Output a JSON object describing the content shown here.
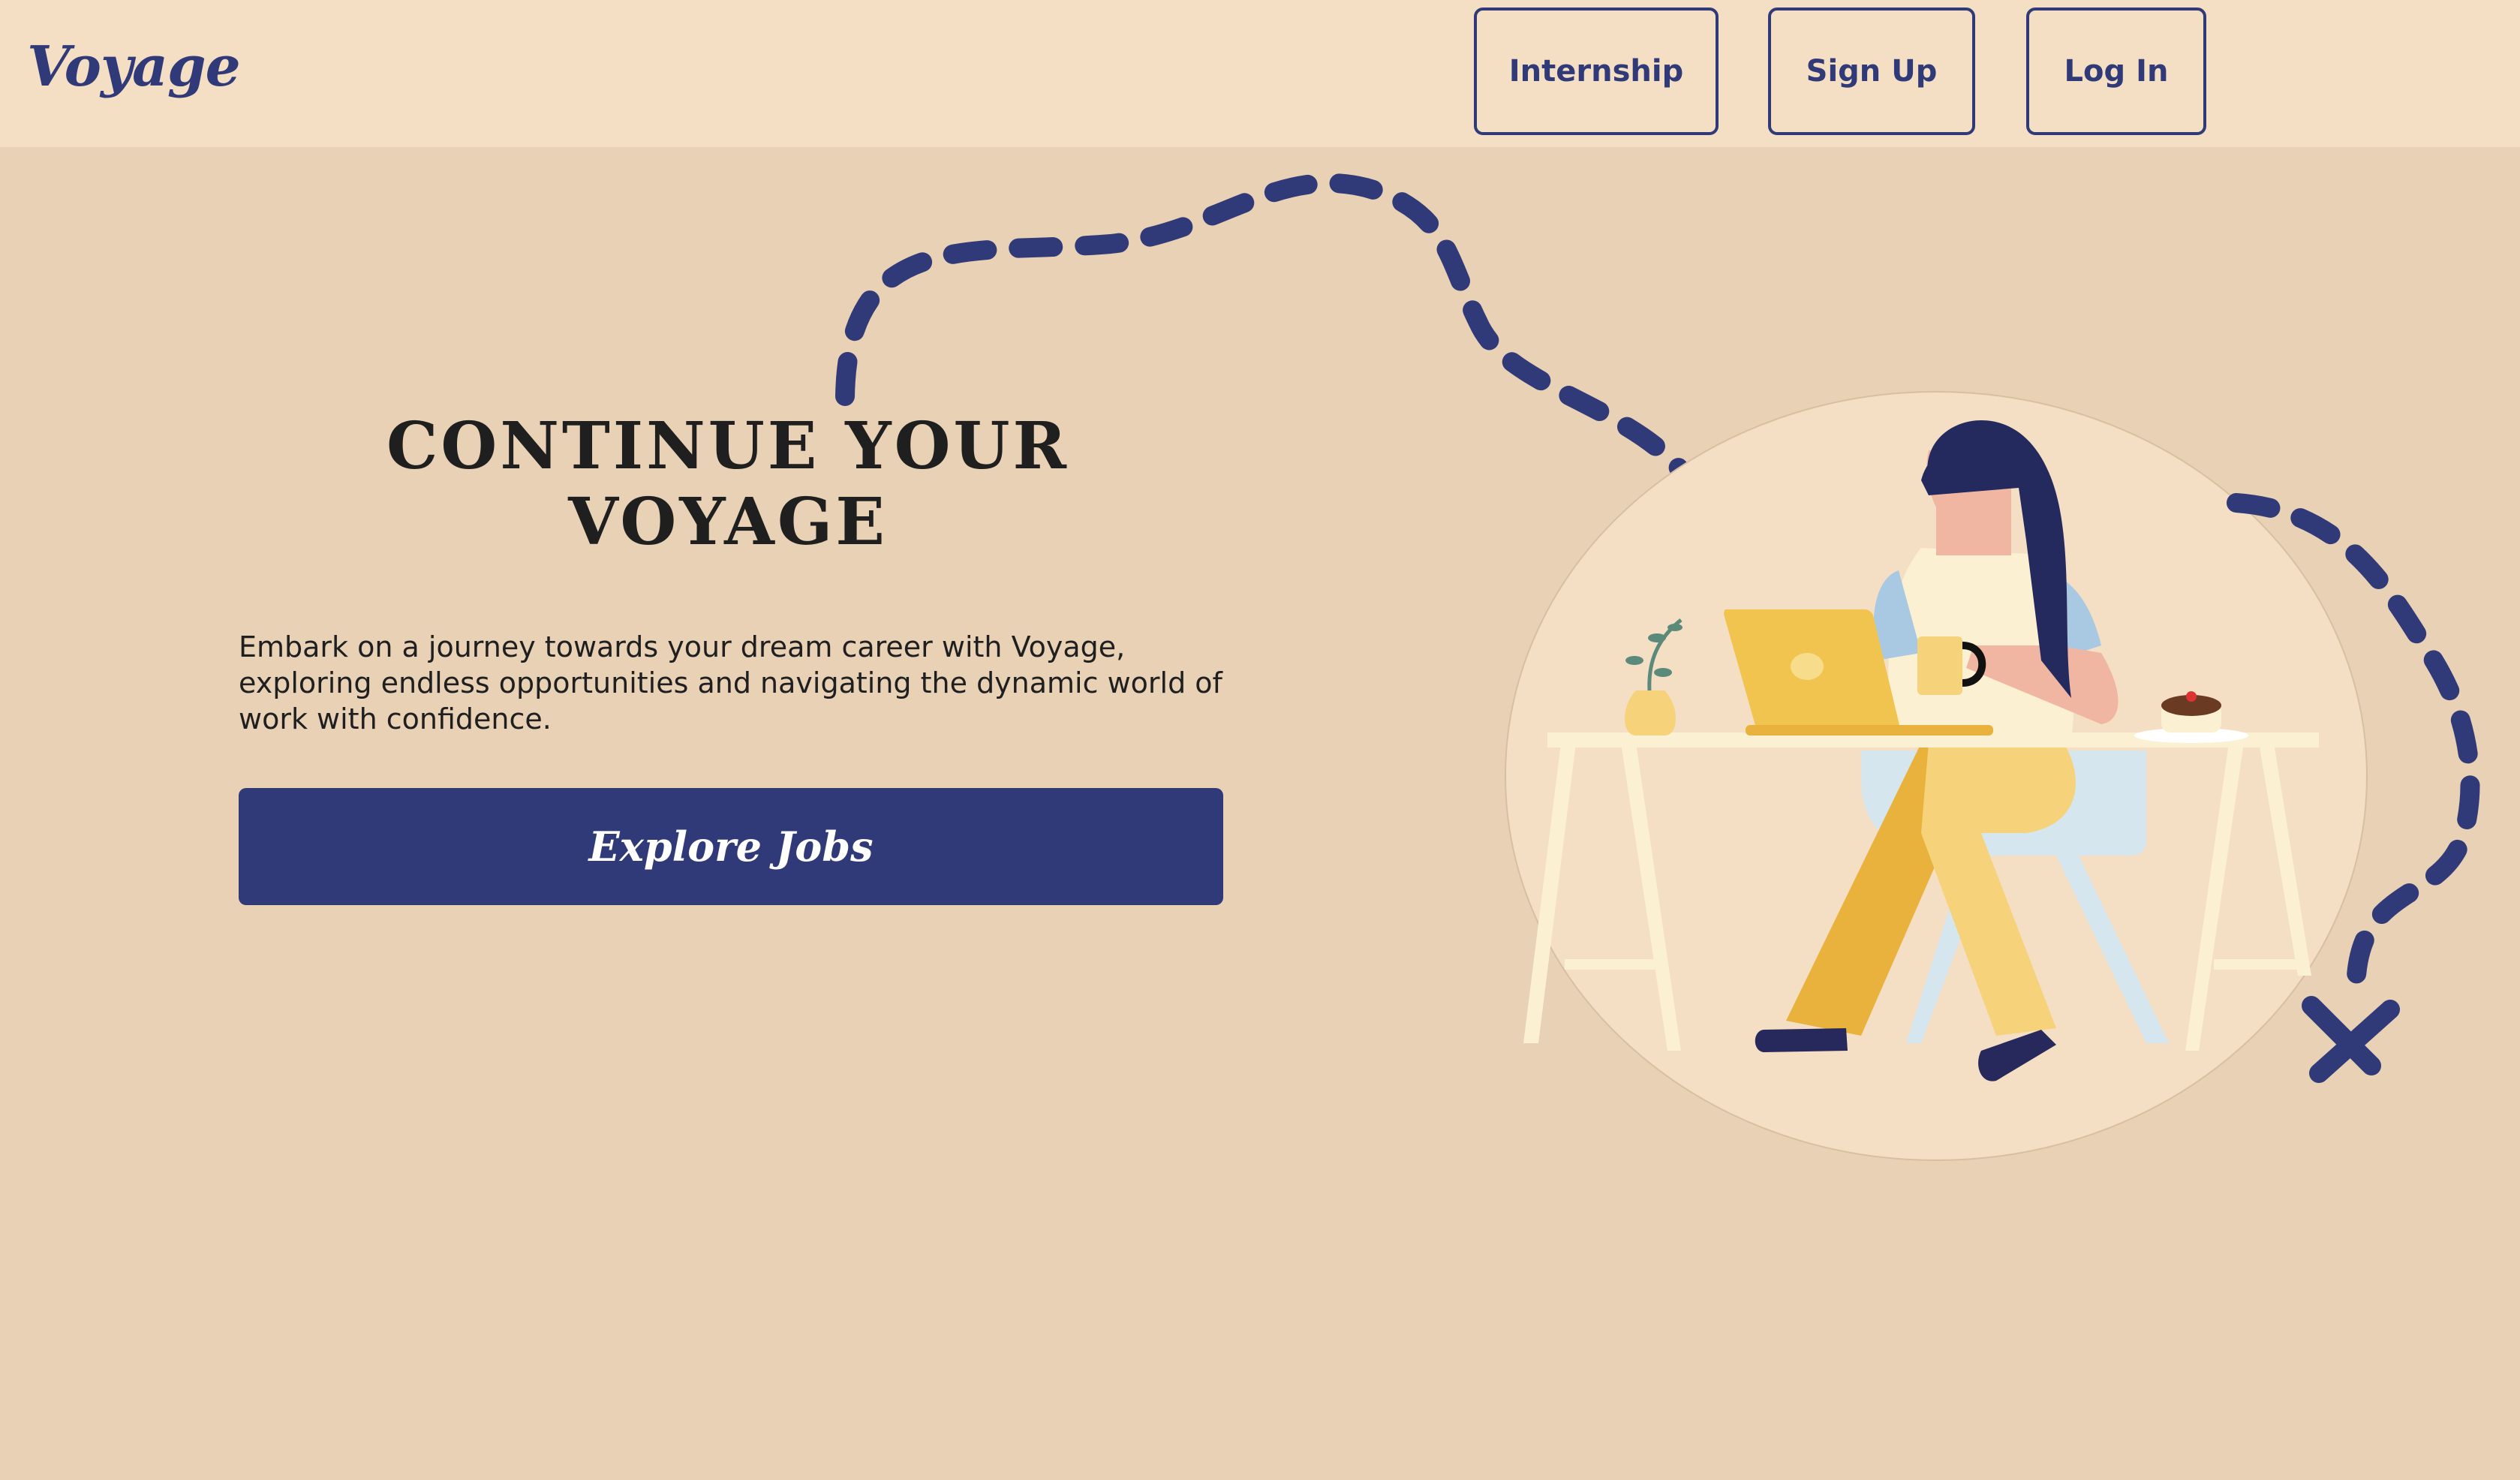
{
  "nav": {
    "logo": "Voyage",
    "internship": "Internship",
    "signup": "Sign Up",
    "login": "Log In"
  },
  "hero": {
    "title": "CONTINUE YOUR VOYAGE",
    "description": "Embark on a journey towards your dream career with Voyage, exploring endless opportunities and navigating the dynamic world of work with confidence.",
    "cta": "Explore Jobs"
  },
  "colors": {
    "page_bg": "#e8d1b5",
    "navbar_bg": "#f4dfc4",
    "accent": "#313a78"
  },
  "illustration": {
    "subject": "woman-working-at-laptop-desk",
    "decorations": [
      "dashed-path",
      "x-mark"
    ]
  }
}
